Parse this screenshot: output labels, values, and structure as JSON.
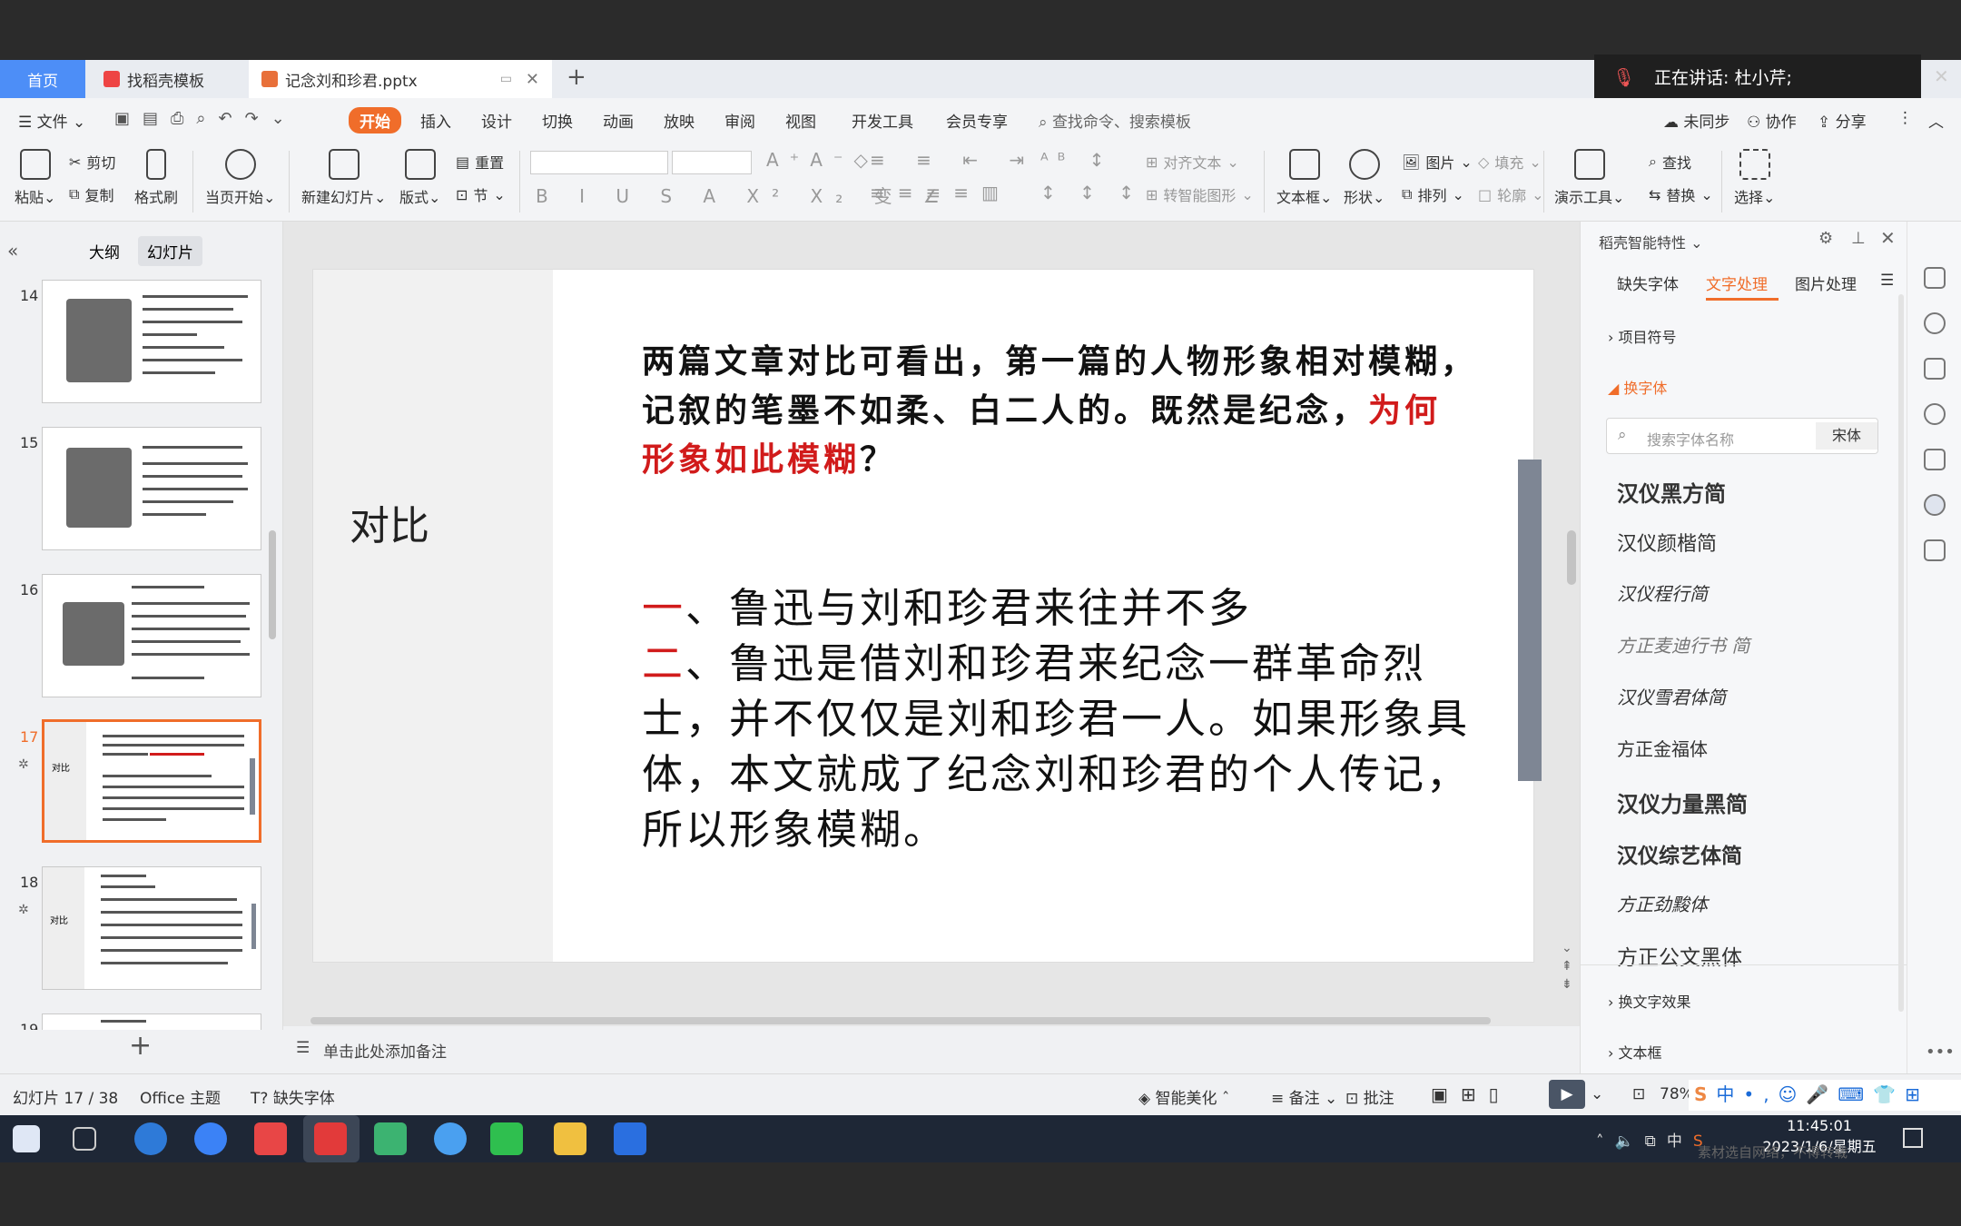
{
  "tabs": {
    "home": "首页",
    "templates": "找稻壳模板",
    "file": "记念刘和珍君.pptx"
  },
  "meeting": {
    "speaking": "正在讲话: 杜小芹;"
  },
  "menu": {
    "file": "文件",
    "items": [
      "开始",
      "插入",
      "设计",
      "切换",
      "动画",
      "放映",
      "审阅",
      "视图",
      "开发工具",
      "会员专享"
    ],
    "search": "查找命令、搜索模板",
    "unsynced": "未同步",
    "collab": "协作",
    "share": "分享"
  },
  "ribbon": {
    "paste": "粘贴",
    "cut": "剪切",
    "copy": "复制",
    "format_painter": "格式刷",
    "from_current": "当页开始",
    "new_slide": "新建幻灯片",
    "layout": "版式",
    "reset": "重置",
    "section": "节",
    "align_text": "对齐文本",
    "to_smartart": "转智能图形",
    "textbox": "文本框",
    "shape": "形状",
    "picture": "图片",
    "arrange": "排列",
    "fill": "填充",
    "outline": "轮廓",
    "presentation_tools": "演示工具",
    "find": "查找",
    "replace": "替换",
    "select": "选择"
  },
  "leftpanel": {
    "outline_tab": "大纲",
    "slides_tab": "幻灯片",
    "slide_numbers": [
      "14",
      "15",
      "16",
      "17",
      "18",
      "19"
    ],
    "thumb17_title": "对比",
    "thumb18_title": "对比"
  },
  "slide": {
    "title": "对比",
    "para1_a": "两篇文章对比可看出，第一篇的人物形象相对模糊，记叙的笔墨不如柔、白二人的。既然是纪念，",
    "para1_red": "为何形象如此模糊",
    "para1_b": "？",
    "item1_num": "一",
    "item1_text": "、鲁迅与刘和珍君来往并不多",
    "item2_num": "二",
    "item2_text": "、鲁迅是借刘和珍君来纪念一群革命烈士，并不仅仅是刘和珍君一人。如果形象具体，本文就成了纪念刘和珍君的个人传记，所以形象模糊。"
  },
  "notes": {
    "placeholder": "单击此处添加备注"
  },
  "rightpanel": {
    "title": "稻壳智能特性",
    "tabs": [
      "缺失字体",
      "文字处理",
      "图片处理"
    ],
    "bullets": "项目符号",
    "change_font": "换字体",
    "search_placeholder": "搜索字体名称",
    "current_font": "宋体",
    "fonts": [
      "汉仪黑方简",
      "汉仪颜楷简",
      "汉仪程行简",
      "方正麦迪行书 简",
      "汉仪雪君体简",
      "方正金福体",
      "汉仪力量黑简",
      "汉仪综艺体简",
      "方正劲黢体",
      "方正公文黑体"
    ],
    "text_effects": "换文字效果",
    "textbox": "文本框"
  },
  "status": {
    "slide_info": "幻灯片 17 / 38",
    "theme": "Office 主题",
    "missing_font": "缺失字体",
    "beautify": "智能美化",
    "notes": "备注",
    "comments": "批注",
    "zoom": "78%"
  },
  "taskbar": {
    "time": "11:45:01",
    "date": "2023/1/6/星期五",
    "ime": "中",
    "watermark": "素材选自网络，不得转载"
  },
  "colors": {
    "accent": "#f06d2a",
    "tab_home": "#4d8ef7",
    "red_text": "#d11b1b"
  }
}
